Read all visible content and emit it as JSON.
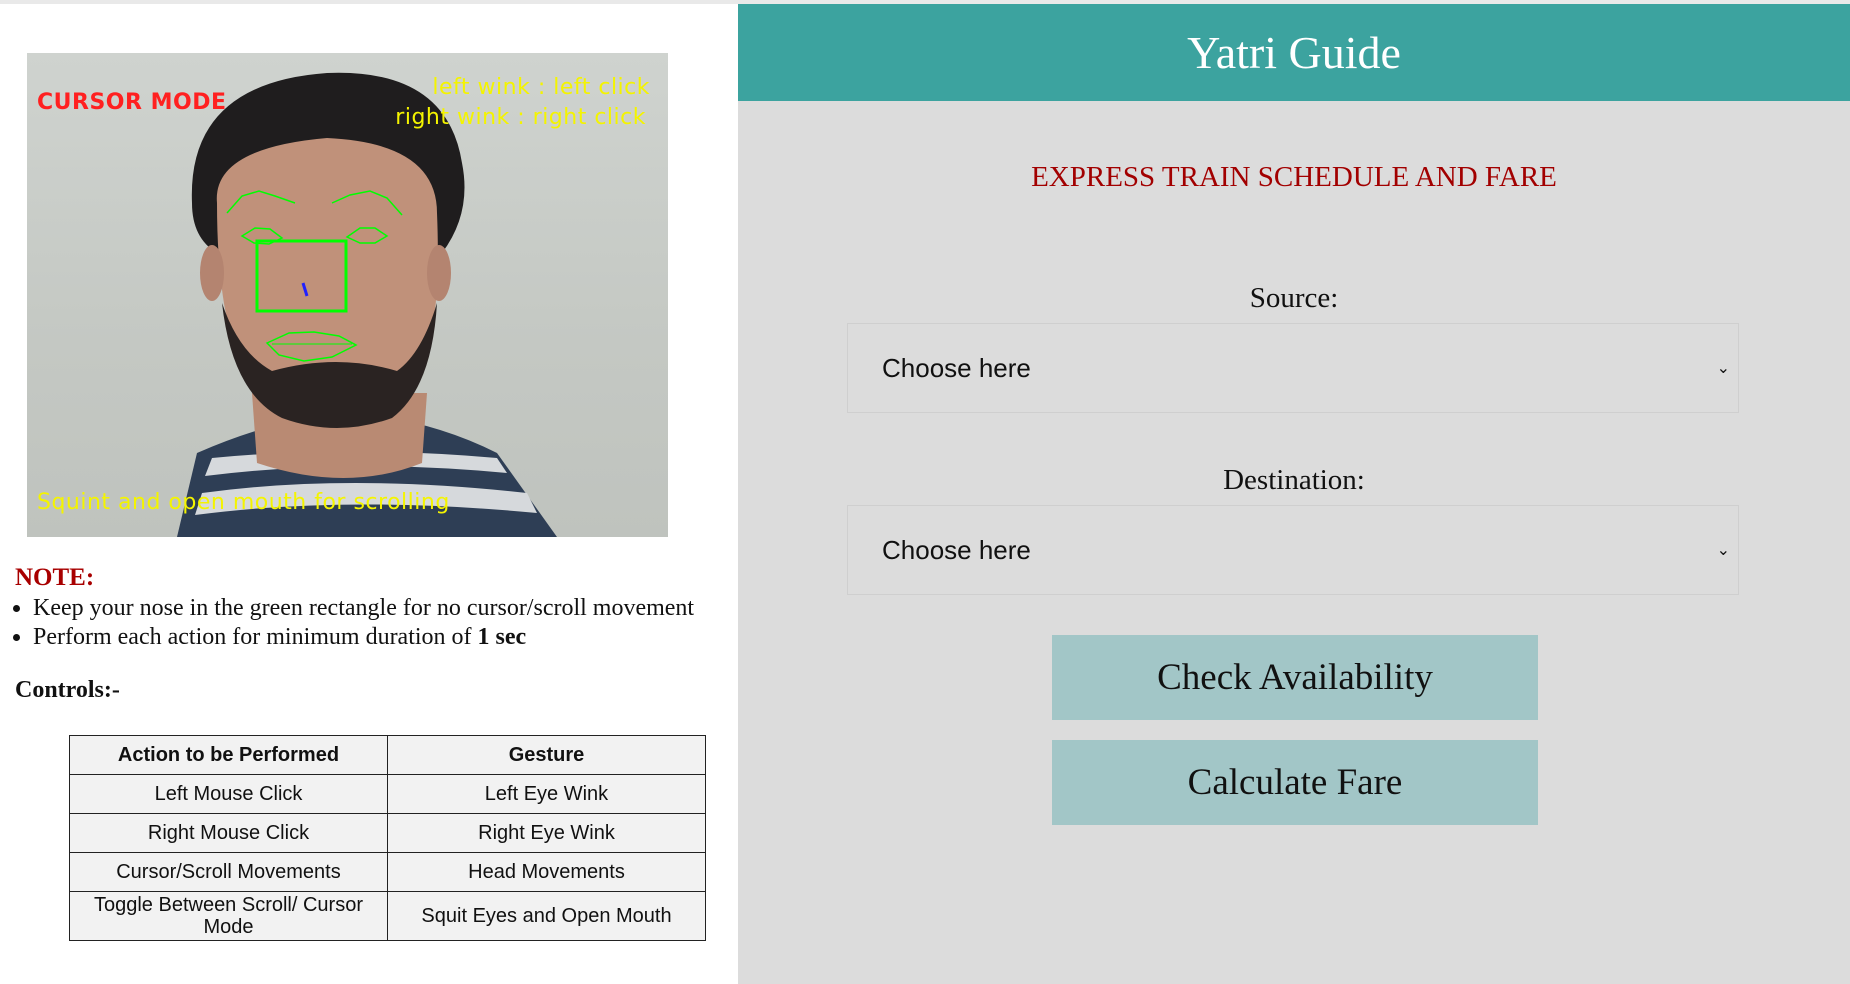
{
  "camera": {
    "mode_text": "CURSOR MODE",
    "left_hint": "left wink : left click",
    "right_hint": "right wink : right click",
    "scroll_hint": "Squint and open mouth for scrolling"
  },
  "note": {
    "title": "NOTE:",
    "items": [
      "Keep your nose in the green rectangle for no cursor/scroll movement",
      "Perform each action for minimum duration of "
    ],
    "duration_bold": "1 sec"
  },
  "controls": {
    "title": "Controls:-",
    "headers": [
      "Action to be Performed",
      "Gesture"
    ],
    "rows": [
      [
        "Left Mouse Click",
        "Left Eye Wink"
      ],
      [
        "Right Mouse Click",
        "Right Eye Wink"
      ],
      [
        "Cursor/Scroll Movements",
        "Head Movements"
      ],
      [
        "Toggle Between Scroll/ Cursor Mode",
        "Squit Eyes and Open Mouth"
      ]
    ]
  },
  "app": {
    "title": "Yatri Guide",
    "subtitle": "EXPRESS TRAIN SCHEDULE AND FARE",
    "source_label": "Source:",
    "source_value": "Choose here",
    "destination_label": "Destination:",
    "destination_value": "Choose here",
    "check_button": "Check Availability",
    "fare_button": "Calculate Fare"
  },
  "colors": {
    "header": "#3ca39f",
    "panel": "#dcdcdc",
    "button": "#a2c6c7",
    "accent_red": "#a20000",
    "landmark_green": "#00ff00"
  }
}
